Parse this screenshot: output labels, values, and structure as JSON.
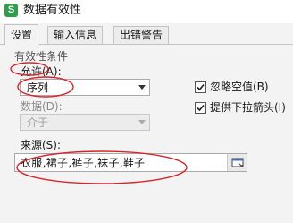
{
  "window": {
    "title": "数据有效性",
    "app_icon_letter": "S"
  },
  "tabs": [
    {
      "label": "设置",
      "active": true
    },
    {
      "label": "输入信息",
      "active": false
    },
    {
      "label": "出错警告",
      "active": false
    }
  ],
  "settings": {
    "section_title": "有效性条件",
    "allow": {
      "label": "允许(A):",
      "value": "序列"
    },
    "data": {
      "label": "数据(D):",
      "value": "介于"
    },
    "ignore_blank": {
      "label": "忽略空值(B)",
      "checked": true
    },
    "dropdown_arrow": {
      "label": "提供下拉箭头(I)",
      "checked": true
    },
    "source": {
      "label": "来源(S):",
      "value": "衣服,裙子,裤子,袜子,鞋子"
    }
  },
  "colors": {
    "annotation": "#d9262c",
    "accent": "#2e9e4a"
  }
}
